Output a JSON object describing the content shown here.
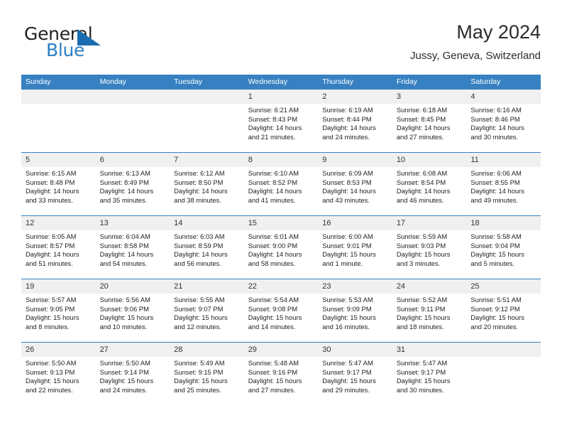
{
  "brand": {
    "name_part1": "General",
    "name_part2": "Blue",
    "triangle_color": "#1b6cb0",
    "blue_color": "#2a7fc4"
  },
  "header": {
    "month_title": "May 2024",
    "location": "Jussy, Geneva, Switzerland"
  },
  "theme": {
    "header_blue": "#3781c2",
    "daynum_band": "#f0f0f0",
    "text": "#222222"
  },
  "weekday_headers": [
    "Sunday",
    "Monday",
    "Tuesday",
    "Wednesday",
    "Thursday",
    "Friday",
    "Saturday"
  ],
  "labels": {
    "sunrise_prefix": "Sunrise:",
    "sunset_prefix": "Sunset:",
    "daylight_prefix": "Daylight:"
  },
  "weeks": [
    {
      "daynums": [
        "",
        "",
        "",
        "1",
        "2",
        "3",
        "4"
      ],
      "cells": [
        {
          "line1": "",
          "line2": "",
          "line3": "",
          "line4": ""
        },
        {
          "line1": "",
          "line2": "",
          "line3": "",
          "line4": ""
        },
        {
          "line1": "",
          "line2": "",
          "line3": "",
          "line4": ""
        },
        {
          "line1": "Sunrise: 6:21 AM",
          "line2": "Sunset: 8:43 PM",
          "line3": "Daylight: 14 hours",
          "line4": "and 21 minutes."
        },
        {
          "line1": "Sunrise: 6:19 AM",
          "line2": "Sunset: 8:44 PM",
          "line3": "Daylight: 14 hours",
          "line4": "and 24 minutes."
        },
        {
          "line1": "Sunrise: 6:18 AM",
          "line2": "Sunset: 8:45 PM",
          "line3": "Daylight: 14 hours",
          "line4": "and 27 minutes."
        },
        {
          "line1": "Sunrise: 6:16 AM",
          "line2": "Sunset: 8:46 PM",
          "line3": "Daylight: 14 hours",
          "line4": "and 30 minutes."
        }
      ]
    },
    {
      "daynums": [
        "5",
        "6",
        "7",
        "8",
        "9",
        "10",
        "11"
      ],
      "cells": [
        {
          "line1": "Sunrise: 6:15 AM",
          "line2": "Sunset: 8:48 PM",
          "line3": "Daylight: 14 hours",
          "line4": "and 33 minutes."
        },
        {
          "line1": "Sunrise: 6:13 AM",
          "line2": "Sunset: 8:49 PM",
          "line3": "Daylight: 14 hours",
          "line4": "and 35 minutes."
        },
        {
          "line1": "Sunrise: 6:12 AM",
          "line2": "Sunset: 8:50 PM",
          "line3": "Daylight: 14 hours",
          "line4": "and 38 minutes."
        },
        {
          "line1": "Sunrise: 6:10 AM",
          "line2": "Sunset: 8:52 PM",
          "line3": "Daylight: 14 hours",
          "line4": "and 41 minutes."
        },
        {
          "line1": "Sunrise: 6:09 AM",
          "line2": "Sunset: 8:53 PM",
          "line3": "Daylight: 14 hours",
          "line4": "and 43 minutes."
        },
        {
          "line1": "Sunrise: 6:08 AM",
          "line2": "Sunset: 8:54 PM",
          "line3": "Daylight: 14 hours",
          "line4": "and 46 minutes."
        },
        {
          "line1": "Sunrise: 6:06 AM",
          "line2": "Sunset: 8:55 PM",
          "line3": "Daylight: 14 hours",
          "line4": "and 49 minutes."
        }
      ]
    },
    {
      "daynums": [
        "12",
        "13",
        "14",
        "15",
        "16",
        "17",
        "18"
      ],
      "cells": [
        {
          "line1": "Sunrise: 6:05 AM",
          "line2": "Sunset: 8:57 PM",
          "line3": "Daylight: 14 hours",
          "line4": "and 51 minutes."
        },
        {
          "line1": "Sunrise: 6:04 AM",
          "line2": "Sunset: 8:58 PM",
          "line3": "Daylight: 14 hours",
          "line4": "and 54 minutes."
        },
        {
          "line1": "Sunrise: 6:03 AM",
          "line2": "Sunset: 8:59 PM",
          "line3": "Daylight: 14 hours",
          "line4": "and 56 minutes."
        },
        {
          "line1": "Sunrise: 6:01 AM",
          "line2": "Sunset: 9:00 PM",
          "line3": "Daylight: 14 hours",
          "line4": "and 58 minutes."
        },
        {
          "line1": "Sunrise: 6:00 AM",
          "line2": "Sunset: 9:01 PM",
          "line3": "Daylight: 15 hours",
          "line4": "and 1 minute."
        },
        {
          "line1": "Sunrise: 5:59 AM",
          "line2": "Sunset: 9:03 PM",
          "line3": "Daylight: 15 hours",
          "line4": "and 3 minutes."
        },
        {
          "line1": "Sunrise: 5:58 AM",
          "line2": "Sunset: 9:04 PM",
          "line3": "Daylight: 15 hours",
          "line4": "and 5 minutes."
        }
      ]
    },
    {
      "daynums": [
        "19",
        "20",
        "21",
        "22",
        "23",
        "24",
        "25"
      ],
      "cells": [
        {
          "line1": "Sunrise: 5:57 AM",
          "line2": "Sunset: 9:05 PM",
          "line3": "Daylight: 15 hours",
          "line4": "and 8 minutes."
        },
        {
          "line1": "Sunrise: 5:56 AM",
          "line2": "Sunset: 9:06 PM",
          "line3": "Daylight: 15 hours",
          "line4": "and 10 minutes."
        },
        {
          "line1": "Sunrise: 5:55 AM",
          "line2": "Sunset: 9:07 PM",
          "line3": "Daylight: 15 hours",
          "line4": "and 12 minutes."
        },
        {
          "line1": "Sunrise: 5:54 AM",
          "line2": "Sunset: 9:08 PM",
          "line3": "Daylight: 15 hours",
          "line4": "and 14 minutes."
        },
        {
          "line1": "Sunrise: 5:53 AM",
          "line2": "Sunset: 9:09 PM",
          "line3": "Daylight: 15 hours",
          "line4": "and 16 minutes."
        },
        {
          "line1": "Sunrise: 5:52 AM",
          "line2": "Sunset: 9:11 PM",
          "line3": "Daylight: 15 hours",
          "line4": "and 18 minutes."
        },
        {
          "line1": "Sunrise: 5:51 AM",
          "line2": "Sunset: 9:12 PM",
          "line3": "Daylight: 15 hours",
          "line4": "and 20 minutes."
        }
      ]
    },
    {
      "daynums": [
        "26",
        "27",
        "28",
        "29",
        "30",
        "31",
        ""
      ],
      "cells": [
        {
          "line1": "Sunrise: 5:50 AM",
          "line2": "Sunset: 9:13 PM",
          "line3": "Daylight: 15 hours",
          "line4": "and 22 minutes."
        },
        {
          "line1": "Sunrise: 5:50 AM",
          "line2": "Sunset: 9:14 PM",
          "line3": "Daylight: 15 hours",
          "line4": "and 24 minutes."
        },
        {
          "line1": "Sunrise: 5:49 AM",
          "line2": "Sunset: 9:15 PM",
          "line3": "Daylight: 15 hours",
          "line4": "and 25 minutes."
        },
        {
          "line1": "Sunrise: 5:48 AM",
          "line2": "Sunset: 9:16 PM",
          "line3": "Daylight: 15 hours",
          "line4": "and 27 minutes."
        },
        {
          "line1": "Sunrise: 5:47 AM",
          "line2": "Sunset: 9:17 PM",
          "line3": "Daylight: 15 hours",
          "line4": "and 29 minutes."
        },
        {
          "line1": "Sunrise: 5:47 AM",
          "line2": "Sunset: 9:17 PM",
          "line3": "Daylight: 15 hours",
          "line4": "and 30 minutes."
        },
        {
          "line1": "",
          "line2": "",
          "line3": "",
          "line4": ""
        }
      ]
    }
  ]
}
